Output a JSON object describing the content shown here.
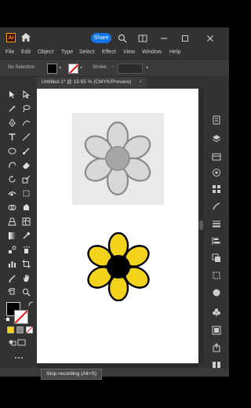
{
  "app": {
    "logo_text": "Ai",
    "share_label": "Share"
  },
  "menu": [
    "File",
    "Edit",
    "Object",
    "Type",
    "Select",
    "Effect",
    "View",
    "Window",
    "Help"
  ],
  "control_bar": {
    "selection_status": "No Selection",
    "stroke_label": "Stroke:"
  },
  "document": {
    "tab_title": "Untitled-1* @ 19.65 % (CMYK/Preview)",
    "close_symbol": "×"
  },
  "tooltip": "Stop recording (Alt+S)",
  "colors": {
    "flower_petal": "#f2d21a",
    "flower_center": "#000000",
    "accent": "#1473e6"
  }
}
